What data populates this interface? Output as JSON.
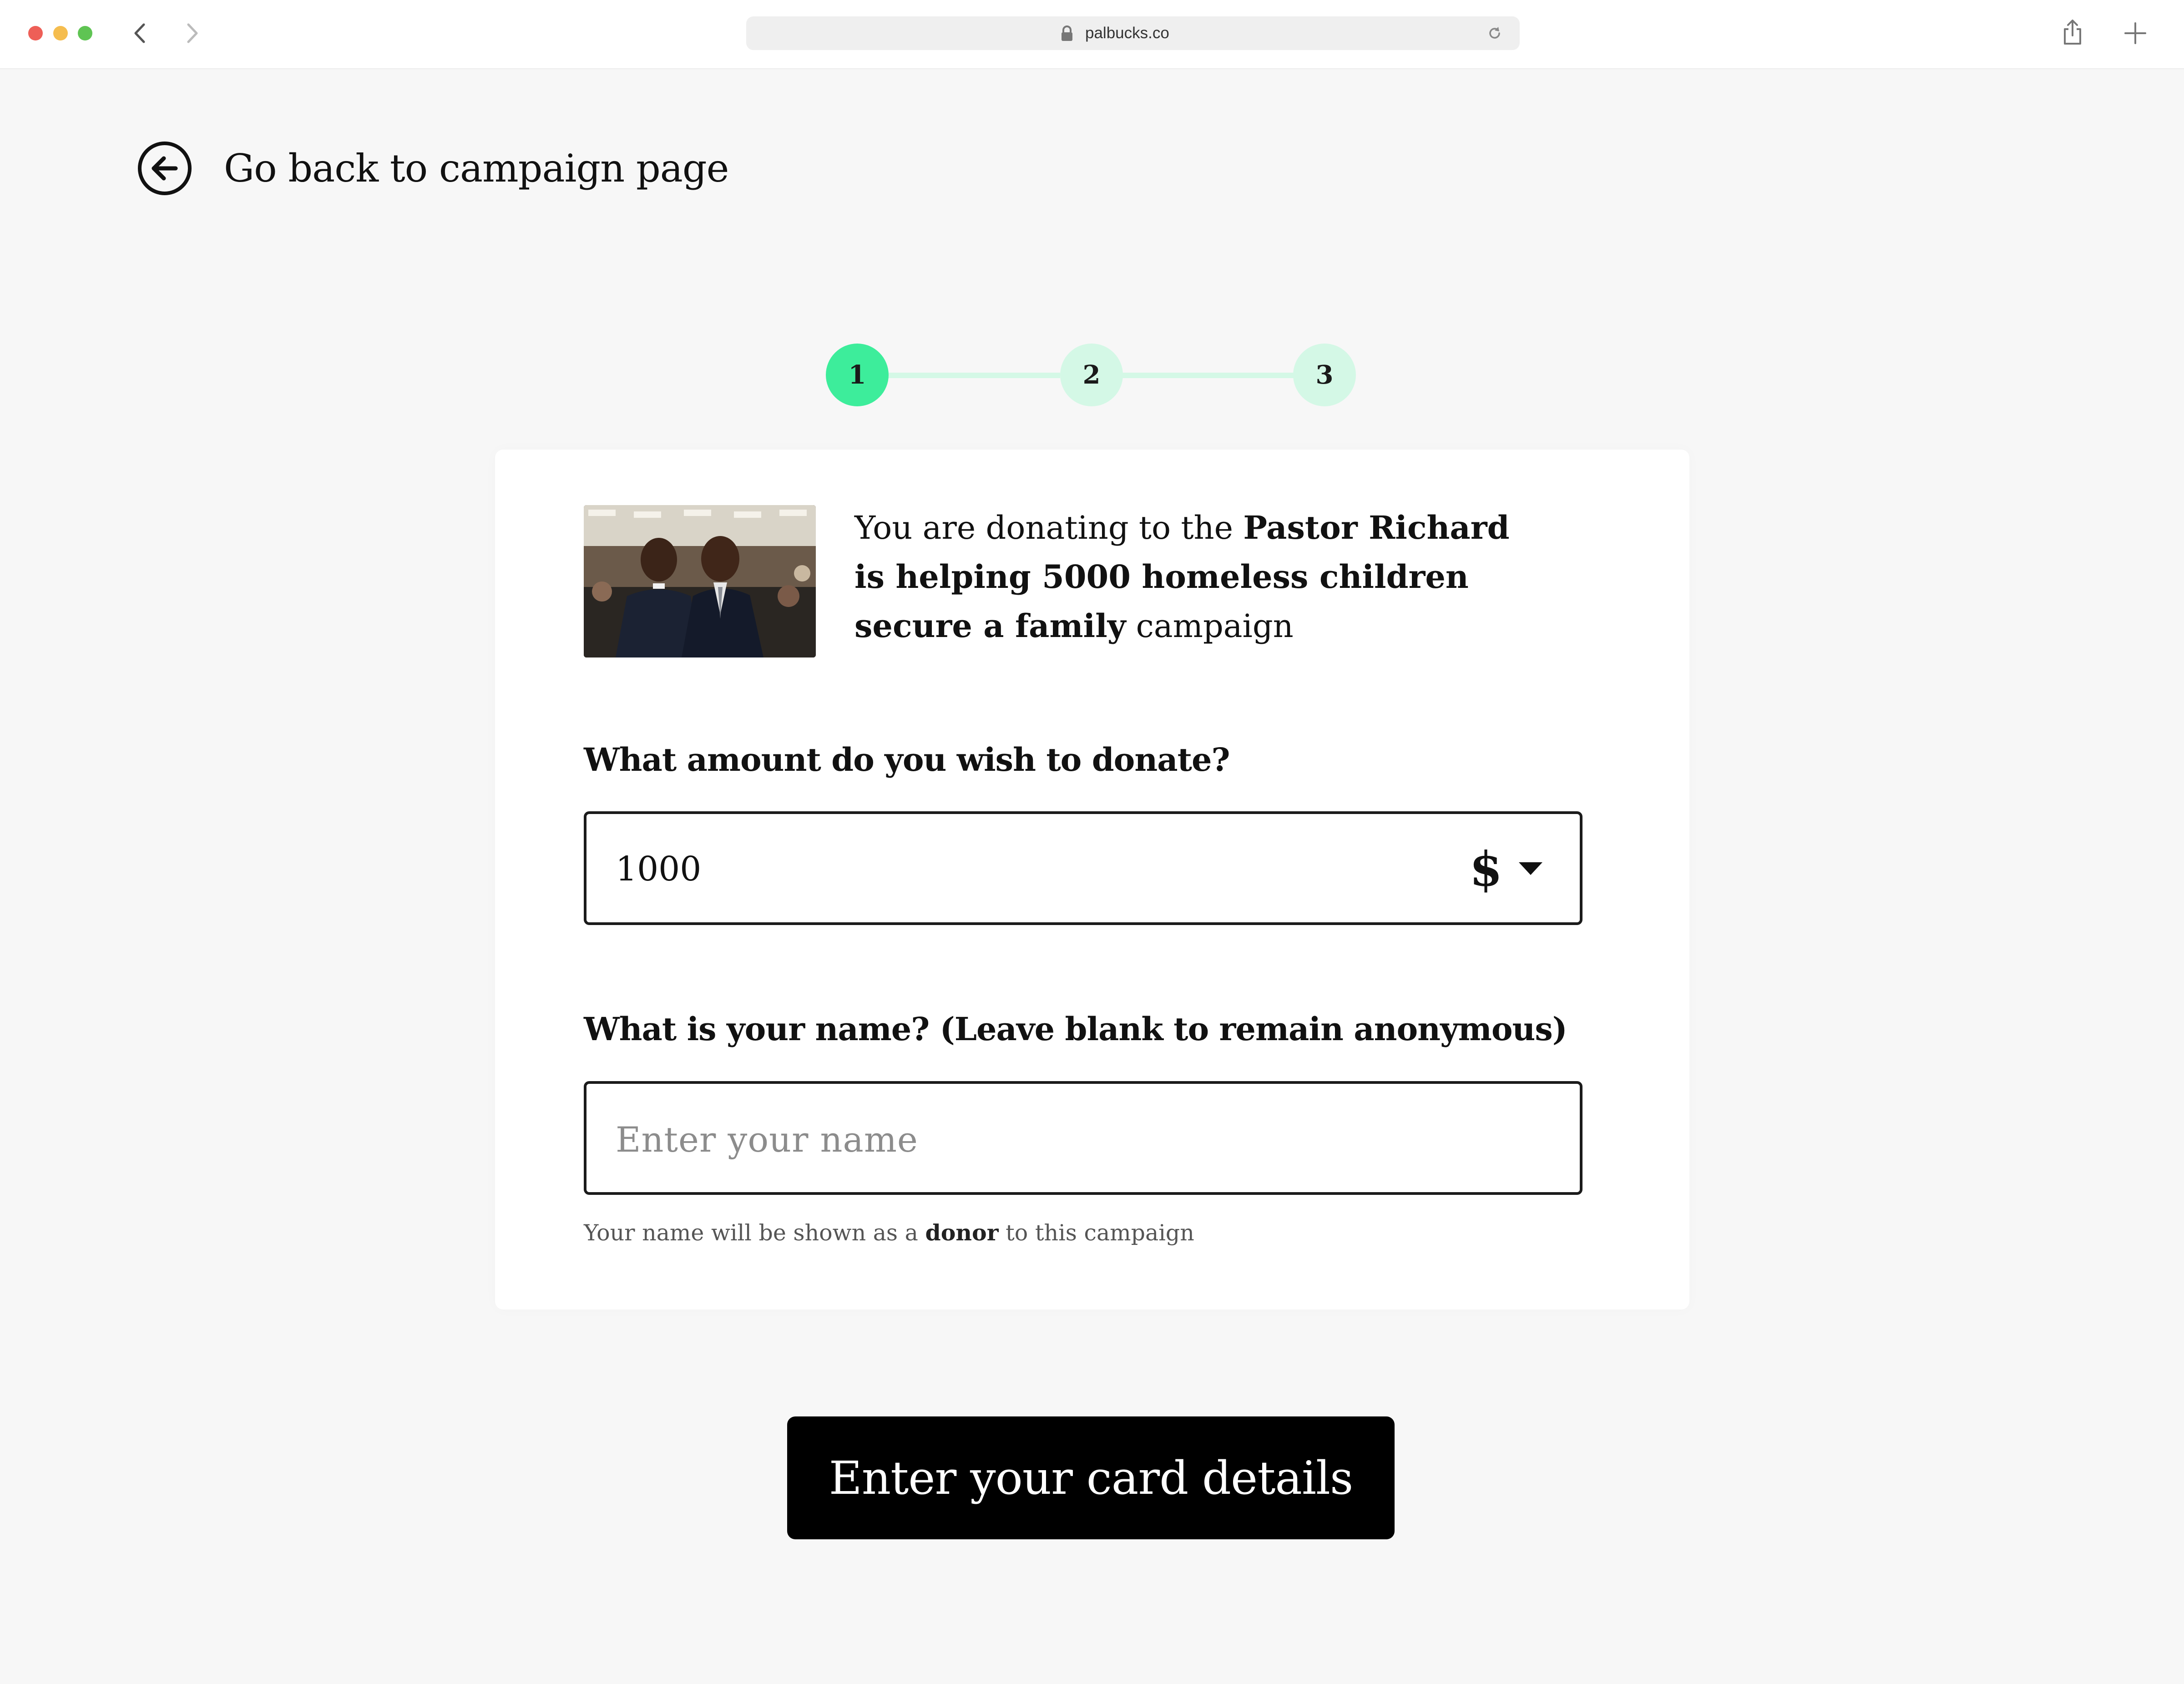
{
  "browser": {
    "url": "palbucks.co"
  },
  "back_link": {
    "label": "Go back to campaign page"
  },
  "stepper": {
    "steps": [
      "1",
      "2",
      "3"
    ],
    "current_step": 1,
    "colors": {
      "active": "#3ded9b",
      "inactive": "#d4f8e6"
    }
  },
  "campaign": {
    "intro": "You are donating to the ",
    "name": "Pastor Richard is helping 5000 homeless children secure a family",
    "suffix": " campaign"
  },
  "amount": {
    "question": "What amount do you wish to donate?",
    "value": "1000",
    "currency": "$"
  },
  "donor_name": {
    "question": "What is your name? (Leave blank to remain anonymous)",
    "placeholder": "Enter your name",
    "value": "",
    "hint_prefix": "Your name will be shown as a ",
    "hint_bold": "donor",
    "hint_suffix": " to this campaign"
  },
  "cta": {
    "label": "Enter your card details",
    "background": "#000000"
  }
}
